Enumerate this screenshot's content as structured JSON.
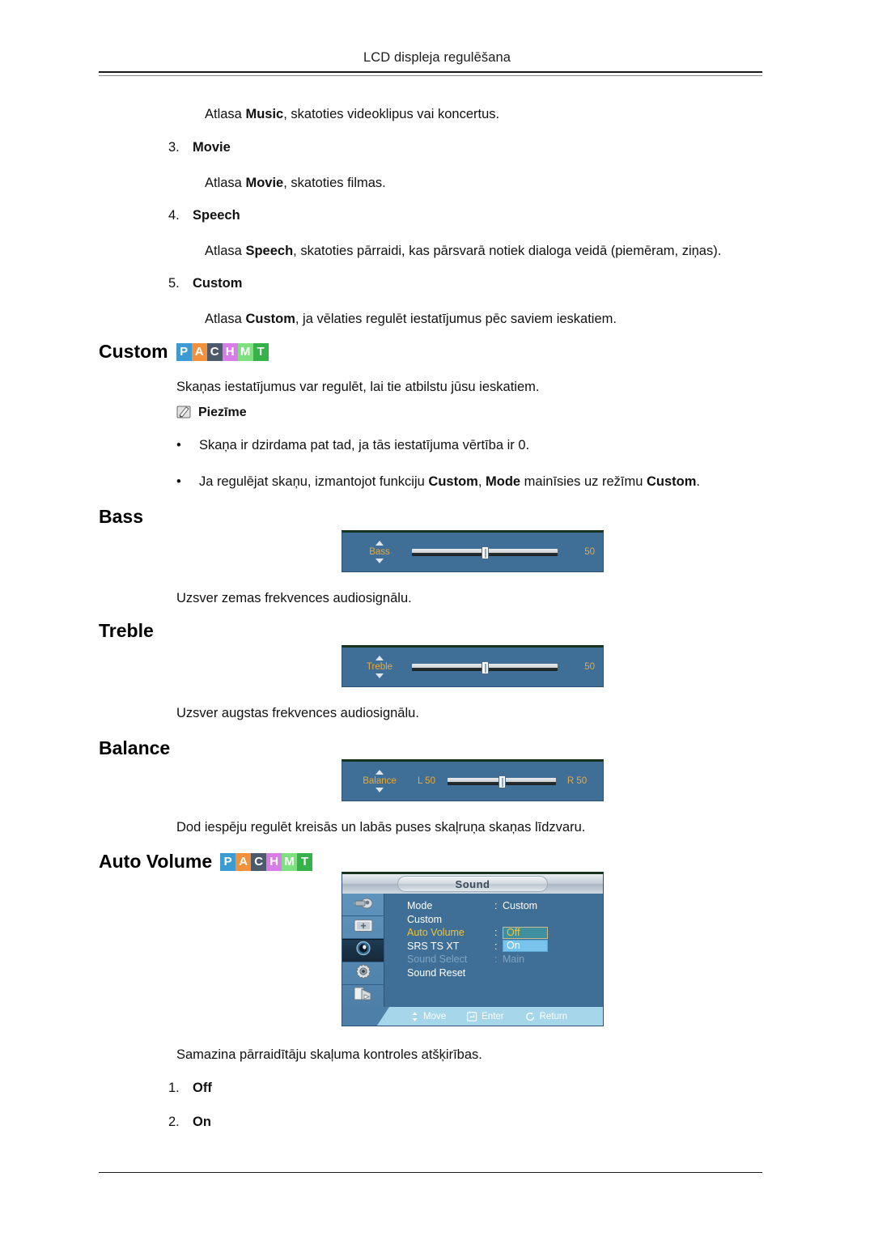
{
  "header": {
    "title": "LCD displeja regulēšana"
  },
  "intro": {
    "music_line_pre": "Atlasa ",
    "music_line_bold": "Music",
    "music_line_post": ", skatoties videoklipus vai koncertus."
  },
  "list_items": [
    {
      "number": "3.",
      "label": "Movie",
      "desc_pre": "Atlasa ",
      "desc_bold": "Movie",
      "desc_post": ", skatoties filmas."
    },
    {
      "number": "4.",
      "label": "Speech",
      "desc_pre": "Atlasa ",
      "desc_bold": "Speech",
      "desc_post": ", skatoties pārraidi, kas pārsvarā notiek dialoga veidā (piemēram, ziņas)."
    },
    {
      "number": "5.",
      "label": "Custom",
      "desc_pre": "Atlasa ",
      "desc_bold": "Custom",
      "desc_post": ", ja vēlaties regulēt iestatījumus pēc saviem ieskatiem."
    }
  ],
  "badges": {
    "cells": [
      {
        "letter": "P",
        "color": "#3d9bd4"
      },
      {
        "letter": "A",
        "color": "#f2903c"
      },
      {
        "letter": "C",
        "color": "#4d5a6b"
      },
      {
        "letter": "H",
        "color": "#d87ce8"
      },
      {
        "letter": "M",
        "color": "#7ee07e"
      },
      {
        "letter": "T",
        "color": "#35b24a"
      }
    ]
  },
  "sections": {
    "custom": {
      "heading": "Custom",
      "desc": "Skaņas iestatījumus var regulēt, lai tie atbilstu jūsu ieskatiem.",
      "note_label": "Piezīme",
      "bullets": [
        {
          "text": "Skaņa ir dzirdama pat tad, ja tās iestatījuma vērtība ir 0."
        }
      ],
      "bullet2": {
        "pre": "Ja regulējat skaņu, izmantojot funkciju ",
        "b1": "Custom",
        "mid1": ", ",
        "b2": "Mode",
        "mid2": " mainīsies uz režīmu ",
        "b3": "Custom",
        "post": "."
      }
    },
    "bass": {
      "heading": "Bass",
      "desc": "Uzsver zemas frekvences audiosignālu.",
      "slider": {
        "label": "Bass",
        "value": "50",
        "knob_percent": 50
      }
    },
    "treble": {
      "heading": "Treble",
      "desc": "Uzsver augstas frekvences audiosignālu.",
      "slider": {
        "label": "Treble",
        "value": "50",
        "knob_percent": 50
      }
    },
    "balance": {
      "heading": "Balance",
      "desc": "Dod iespēju regulēt kreisās un labās puses skaļruņa skaņas līdzvaru.",
      "slider": {
        "label": "Balance",
        "left_value": "L  50",
        "right_value": "R  50",
        "knob_percent": 50
      }
    },
    "auto_volume": {
      "heading": "Auto Volume",
      "desc": "Samazina pārraidītāju skaļuma kontroles atšķirības.",
      "options": [
        {
          "number": "1.",
          "label": "Off"
        },
        {
          "number": "2.",
          "label": "On"
        }
      ]
    }
  },
  "osd_menu": {
    "title": "Sound",
    "sidebar_icons": [
      "input-source-icon",
      "picture-icon",
      "sound-icon",
      "setup-gear-icon",
      "multi-control-icon"
    ],
    "rows": [
      {
        "label": "Mode",
        "colon": ":",
        "value": "Custom",
        "state": "normal",
        "value_style": "plain"
      },
      {
        "label": "Custom",
        "colon": "",
        "value": "",
        "state": "normal",
        "value_style": "plain"
      },
      {
        "label": "Auto Volume",
        "colon": ":",
        "value": "Off",
        "state": "selected",
        "value_style": "box-off"
      },
      {
        "label": "SRS TS XT",
        "colon": ":",
        "value": "On",
        "state": "normal",
        "value_style": "box-on"
      },
      {
        "label": "Sound Select",
        "colon": ":",
        "value": "Main",
        "state": "disabled",
        "value_style": "plain"
      },
      {
        "label": "Sound Reset",
        "colon": "",
        "value": "",
        "state": "normal",
        "value_style": "plain"
      }
    ],
    "footer": [
      {
        "icon": "move-updown-icon",
        "label": "Move"
      },
      {
        "icon": "enter-icon",
        "label": "Enter"
      },
      {
        "icon": "return-icon",
        "label": "Return"
      }
    ]
  }
}
